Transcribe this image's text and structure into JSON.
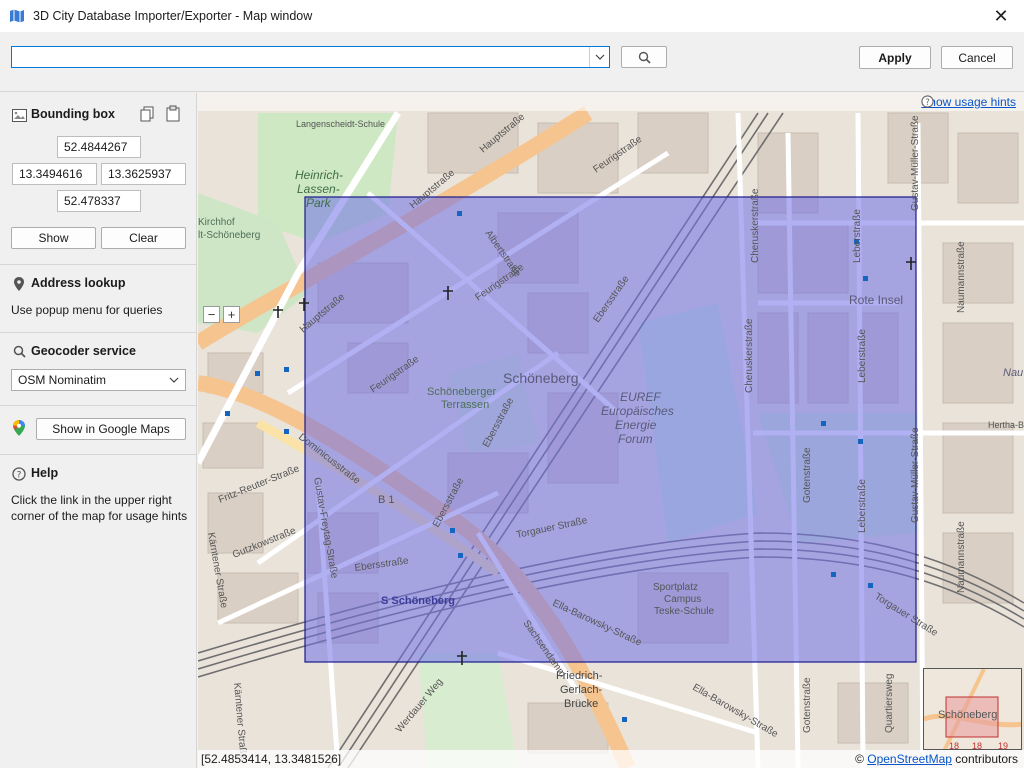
{
  "window": {
    "title": "3D City Database Importer/Exporter - Map window",
    "close_glyph": "✕"
  },
  "toolbar": {
    "search_value": "",
    "search_icon": "magnifier-icon",
    "apply_label": "Apply",
    "cancel_label": "Cancel"
  },
  "bbox": {
    "title": "Bounding box",
    "north": "52.4844267",
    "west": "13.3494616",
    "east": "13.3625937",
    "south": "52.478337",
    "show_label": "Show",
    "clear_label": "Clear"
  },
  "address": {
    "title": "Address lookup",
    "text": "Use popup menu for queries"
  },
  "geocoder": {
    "title": "Geocoder service",
    "selected": "OSM Nominatim"
  },
  "google": {
    "button_label": "Show in Google Maps"
  },
  "help": {
    "title": "Help",
    "text_line1": "Click the link in the upper right",
    "text_line2": "corner of the map for usage hints"
  },
  "map": {
    "hints_link": "Show usage hints",
    "zoom_out": "−",
    "zoom_in": "+",
    "coordinates": "[52.4853414,  13.3481526]",
    "attribution_prefix": "© ",
    "attribution_link": "OpenStreetMap",
    "attribution_suffix": " contributors",
    "labels": {
      "schoeneberg": "Schöneberg",
      "euref1": "EUREF",
      "euref2": "Europäisches",
      "euref3": "Energie",
      "euref4": "Forum",
      "terrassen1": "Schöneberger",
      "terrassen2": "Terrassen",
      "rote_insel": "Rote Insel",
      "heinrich1": "Heinrich-",
      "heinrich2": "Lassen-",
      "heinrich3": "Park",
      "hauptstrasse": "Hauptstraße",
      "dominicusstrasse": "Dominicusstraße",
      "feurigstrasse": "Feurigstraße",
      "ebersstrasse": "Ebersstraße",
      "leberstrasse": "Leberstraße",
      "cheruskerstrasse": "Cheruskerstraße",
      "gotenstrasse": "Gotenstraße",
      "gustav_mueller": "Gustav-Müller-Straße",
      "torgauer": "Torgauer Straße",
      "sachsendamm": "Sachsendamm",
      "ella_barowsky": "Ella-Barowsky-Straße",
      "s_schoeneberg": "S Schöneberg",
      "friedrich1": "Friedrich-",
      "friedrich2": "Gerlach-",
      "friedrich3": "Brücke",
      "sportplatz1": "Sportplatz",
      "sportplatz2": "Campus",
      "sportplatz3": "Teske-Schule",
      "b1": "B 1",
      "naumannstrasse": "Naumannstraße",
      "kamenzer": "Kärntener Straße",
      "gutzkowstrasse": "Gutzkowstraße",
      "fritz_reuter": "Fritz-Reuter-Straße",
      "gustav_freytag": "Gustav-Freytag-Straße",
      "albertstrasse": "Albertstraße",
      "werdauer": "Werdauer Weg",
      "hertha": "Hertha-Blo",
      "kirchhof1": "Kirchhof",
      "kirchhof2": "lt-Schöneberg",
      "quartiersweg": "Quartiersweg",
      "minimap_label": "Schöneberg",
      "minimap_n1": "18",
      "minimap_n2": "18",
      "minimap_n3": "19",
      "schule": "Langenscheidt-Schule",
      "nau": "Nau"
    }
  },
  "colors": {
    "bbox_fill": "#7070e8",
    "bbox_stroke": "#1a1a8a",
    "accent": "#0078d7"
  }
}
